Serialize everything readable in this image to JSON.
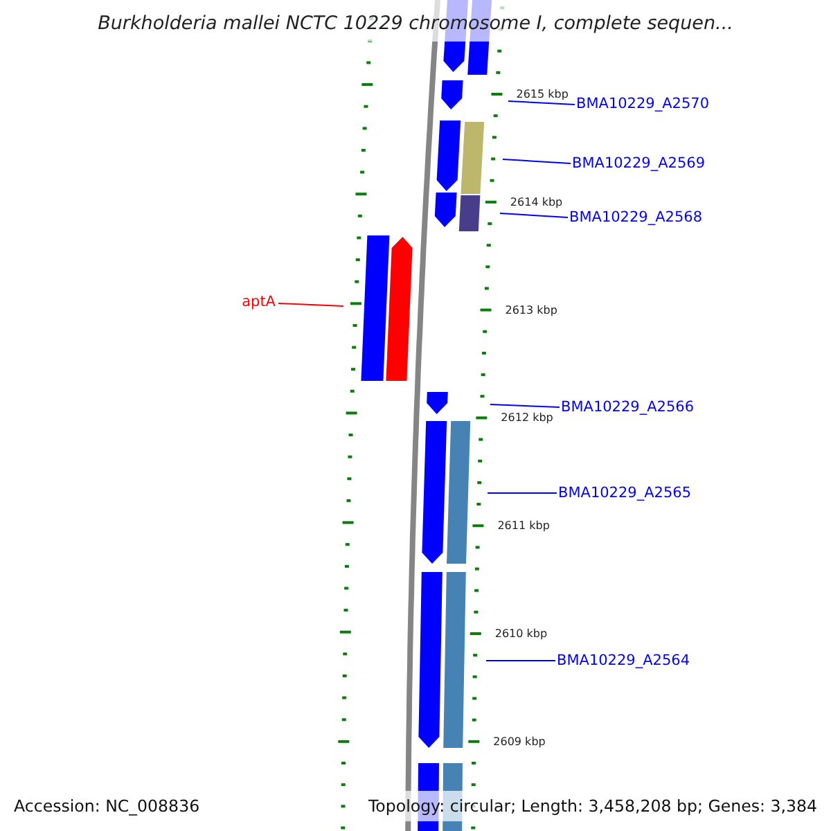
{
  "title": "Burkholderia mallei NCTC 10229 chromosome I, complete sequen...",
  "map": {
    "features": [
      {
        "kind": "arrow",
        "points_up": false,
        "color": "#0000ff"
      },
      {
        "kind": "block",
        "color": "#0000ff"
      },
      {
        "kind": "arrow",
        "points_up": false,
        "color": "#0000ff"
      },
      {
        "kind": "arrow",
        "points_up": false,
        "color": "#0000ff"
      },
      {
        "kind": "block",
        "color": "#bdb76b"
      },
      {
        "kind": "arrow",
        "points_up": false,
        "color": "#0000ff"
      },
      {
        "kind": "block",
        "color": "#483d8b"
      },
      {
        "kind": "block",
        "color": "#0000ff"
      },
      {
        "kind": "arrow",
        "points_up": true,
        "color": "#ff0000"
      },
      {
        "kind": "arrow",
        "points_up": false,
        "color": "#0000ff"
      },
      {
        "kind": "arrow",
        "points_up": false,
        "color": "#0000ff"
      },
      {
        "kind": "block",
        "color": "#4682b4"
      },
      {
        "kind": "arrow",
        "points_up": false,
        "color": "#0000ff"
      },
      {
        "kind": "block",
        "color": "#4682b4"
      },
      {
        "kind": "block",
        "color": "#0000ff"
      },
      {
        "kind": "block",
        "color": "#4682b4"
      }
    ],
    "scale": {
      "tick_labels": [
        "2615 kbp",
        "2614 kbp",
        "2613 kbp",
        "2612 kbp",
        "2611 kbp",
        "2610 kbp",
        "2609 kbp"
      ]
    },
    "labels": [
      {
        "text": "BMA10229_A2570",
        "color": "#0000ff"
      },
      {
        "text": "BMA10229_A2569",
        "color": "#0000ff"
      },
      {
        "text": "BMA10229_A2568",
        "color": "#0000ff"
      },
      {
        "text": "aptA",
        "color": "#ff0000"
      },
      {
        "text": "BMA10229_A2566",
        "color": "#0000ff"
      },
      {
        "text": "BMA10229_A2565",
        "color": "#0000ff"
      },
      {
        "text": "BMA10229_A2564",
        "color": "#0000ff"
      }
    ]
  },
  "footer": {
    "accession": "Accession: NC_008836",
    "summary": "Topology: circular; Length: 3,458,208 bp; Genes: 3,384"
  }
}
